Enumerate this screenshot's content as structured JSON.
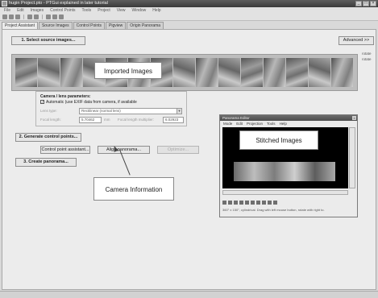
{
  "window": {
    "title": "hugin Project.pto - PTGui explained in later tutorial",
    "buttons": [
      "_",
      "□",
      "×"
    ]
  },
  "menubar": [
    "File",
    "Edit",
    "Images",
    "Control Points",
    "Tools",
    "Project",
    "View",
    "Window",
    "Help"
  ],
  "toolbar": {
    "icons": [
      "new-icon",
      "open-icon",
      "save-icon",
      "undo-icon",
      "redo-icon",
      "optimize-icon",
      "preview-icon",
      "stitch-icon"
    ]
  },
  "tabs": [
    "Project Assistant",
    "Source Images",
    "Control Points",
    "Pigview",
    "Origin Panorama"
  ],
  "assistant": {
    "select_source_images": "1. Select source images...",
    "advanced": "Advanced >>",
    "generate_control_points": "2. Generate control points...",
    "create_panorama": "3. Create panorama..."
  },
  "side_options": [
    "rotate",
    "rotate"
  ],
  "camera": {
    "title": "Camera / lens parameters:",
    "auto_exif_checked": true,
    "auto_exif_label": "Automatic (use EXIF data from camera, if available",
    "lens_type_label": "Lens type:",
    "lens_type_value": "Rectilinear (normal lens)",
    "focal_length_label": "Focal length:",
    "focal_length_value": "5.70462",
    "focal_length_unit": "mm",
    "multiplier_label": "Focal length multiplier:",
    "multiplier_value": "6.02923"
  },
  "cp_buttons": {
    "control_point_assistant": "Control point assistant...",
    "align_panorama": "Align panorama...",
    "optimize": "Optimize..."
  },
  "callouts": {
    "imported_images": "Imported Images",
    "stitched_images": "Stitched Images",
    "camera_information": "Camera Information"
  },
  "pano_editor": {
    "title": "Panorama Editor",
    "close": "×",
    "menu": [
      "Mode",
      "Edit",
      "Projection",
      "Tools",
      "Help"
    ],
    "status": "360° x 150°, cylindrical. Drag with left mouse button, rotate with right to."
  },
  "thumbnail_count": 15
}
